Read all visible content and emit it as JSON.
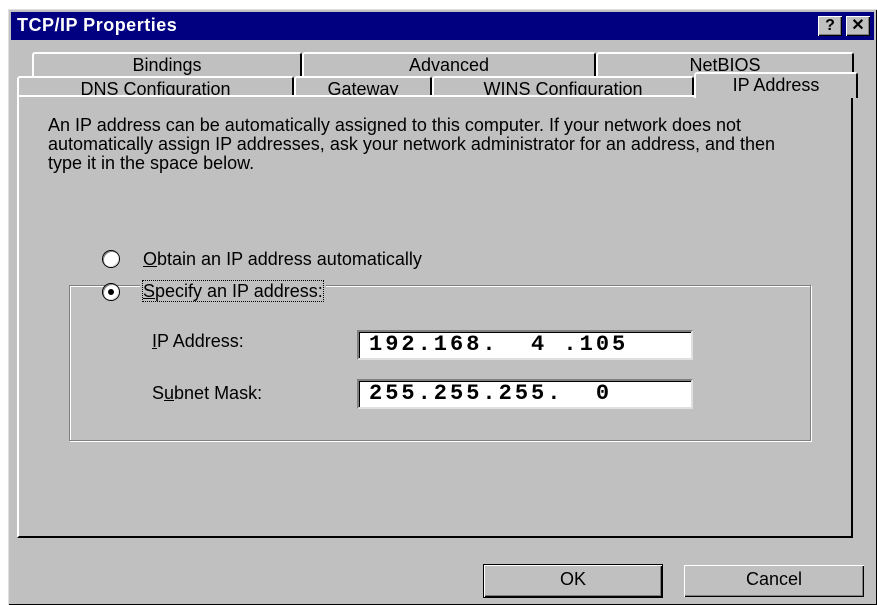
{
  "window": {
    "title": "TCP/IP Properties",
    "help_label": "?",
    "close_label": "✕"
  },
  "tabs": {
    "row_back": [
      "Bindings",
      "Advanced",
      "NetBIOS"
    ],
    "row_front": [
      "DNS Configuration",
      "Gateway",
      "WINS Configuration",
      "IP Address"
    ],
    "active": "IP Address"
  },
  "panel": {
    "description": "An IP address can be automatically assigned to this computer. If your network does not automatically assign IP addresses, ask your network administrator for an address, and then type it in the space below.",
    "option_auto": {
      "mnemonic": "O",
      "rest": "btain an IP address automatically",
      "selected": false
    },
    "option_specify": {
      "mnemonic": "S",
      "rest": "pecify an IP address:",
      "selected": true
    },
    "ip_address": {
      "label_mnemonic": "I",
      "label_rest": "P Address:",
      "value": "192.168.  4 .105"
    },
    "subnet_mask": {
      "label_pre": "S",
      "label_mnemonic": "u",
      "label_rest": "bnet Mask:",
      "value": "255.255.255.  0"
    }
  },
  "buttons": {
    "ok": "OK",
    "cancel": "Cancel"
  }
}
